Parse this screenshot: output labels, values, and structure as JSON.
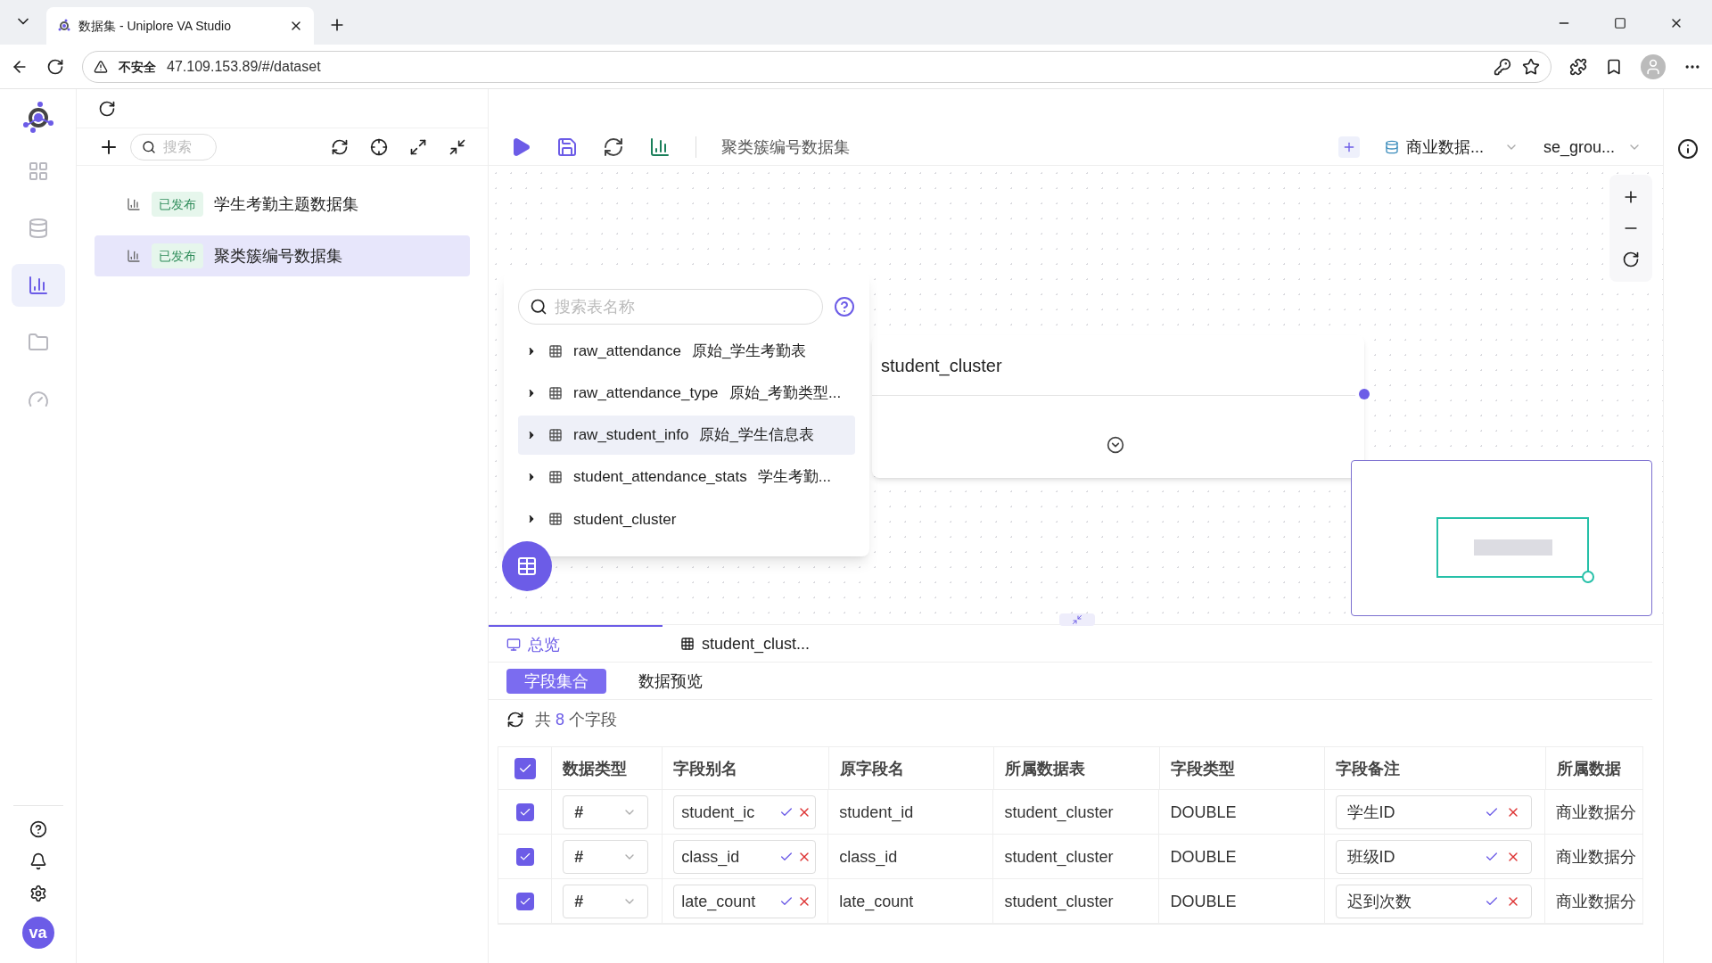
{
  "browser": {
    "tab_title": "数据集 - Uniplore VA Studio",
    "security": "不安全",
    "url": "47.109.153.89/#/dataset"
  },
  "nav_items": [
    {
      "kind": "apps",
      "selected": false
    },
    {
      "kind": "database",
      "selected": false
    },
    {
      "kind": "dataset",
      "selected": true
    },
    {
      "kind": "folder",
      "selected": false
    },
    {
      "kind": "gauge",
      "selected": false
    }
  ],
  "left_panel": {
    "search_placeholder": "搜索",
    "items": [
      {
        "badge": "已发布",
        "name": "学生考勤主题数据集",
        "selected": false
      },
      {
        "badge": "已发布",
        "name": "聚类簇编号数据集",
        "selected": true
      }
    ]
  },
  "toolbar": {
    "title": "聚类簇编号数据集",
    "source": "商业数据...",
    "schema": "se_grou..."
  },
  "table_picker": {
    "search_placeholder": "搜索表名称",
    "tables": [
      {
        "name": "raw_attendance",
        "comment": "原始_学生考勤表",
        "hovered": false
      },
      {
        "name": "raw_attendance_type",
        "comment": "原始_考勤类型...",
        "hovered": false
      },
      {
        "name": "raw_student_info",
        "comment": "原始_学生信息表",
        "hovered": true
      },
      {
        "name": "student_attendance_stats",
        "comment": "学生考勤...",
        "hovered": false
      },
      {
        "name": "student_cluster",
        "hovered": false
      }
    ]
  },
  "user": {
    "initials": "va"
  },
  "node": {
    "title": "student_cluster"
  },
  "bottom_tabs": [
    {
      "kind": "overview",
      "label": "总览",
      "selected": true
    },
    {
      "kind": "table",
      "label": "student_clust...",
      "selected": false
    }
  ],
  "sub_tabs": [
    {
      "label": "字段集合",
      "selected": true
    },
    {
      "label": "数据预览",
      "selected": false
    }
  ],
  "field_count": {
    "prefix": "共",
    "count": "8",
    "suffix": "个字段"
  },
  "table": {
    "all_checked": true,
    "columns": [
      "数据类型",
      "字段别名",
      "原字段名",
      "所属数据表",
      "字段类型",
      "字段备注",
      "所属数据"
    ],
    "rows": [
      {
        "checked": true,
        "type": "#",
        "alias": "student_ic",
        "original": "student_id",
        "table": "student_cluster",
        "field_type": "DOUBLE",
        "remark": "学生ID",
        "source": "商业数据分"
      },
      {
        "checked": true,
        "type": "#",
        "alias": "class_id",
        "original": "class_id",
        "table": "student_cluster",
        "field_type": "DOUBLE",
        "remark": "班级ID",
        "source": "商业数据分"
      },
      {
        "checked": true,
        "type": "#",
        "alias": "late_count",
        "original": "late_count",
        "table": "student_cluster",
        "field_type": "DOUBLE",
        "remark": "迟到次数",
        "source": "商业数据分"
      }
    ]
  }
}
